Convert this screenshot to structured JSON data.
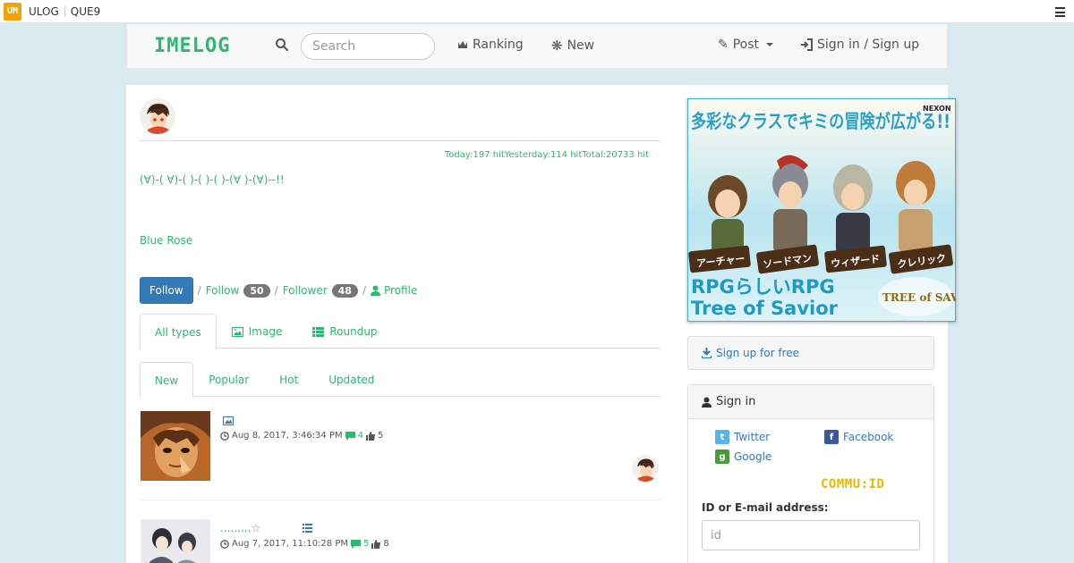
{
  "topbar": {
    "logo": "UM",
    "links": [
      "ULOG",
      "QUE9"
    ]
  },
  "navbar": {
    "brand": "IMELOG",
    "search_placeholder": "Search",
    "ranking": "Ranking",
    "new": "New",
    "post": "Post",
    "sign": "Sign in / Sign up"
  },
  "profile": {
    "hits": "Today:197 hitYesterday:114 hitTotal:20733 hit",
    "message": "(∀)-( ∀)-( )-( )-( )-(∀ )-(∀)--!!",
    "name": "Blue Rose",
    "follow_button": "Follow",
    "follow_label": "Follow",
    "follow_count": "50",
    "follower_label": "Follower",
    "follower_count": "48",
    "profile_label": "Profile"
  },
  "type_tabs": [
    {
      "label": "All types",
      "icon": "",
      "active": true
    },
    {
      "label": "Image",
      "icon": "image-icon",
      "active": false
    },
    {
      "label": "Roundup",
      "icon": "list-icon",
      "active": false
    }
  ],
  "sort_tabs": [
    {
      "label": "New",
      "active": true
    },
    {
      "label": "Popular",
      "active": false
    },
    {
      "label": "Hot",
      "active": false
    },
    {
      "label": "Updated",
      "active": false
    }
  ],
  "entries": [
    {
      "title": "",
      "type_icon": "image-icon",
      "date": "Aug 8, 2017, 3:46:34 PM",
      "comments": "4",
      "likes": "5"
    },
    {
      "title": ".........☆",
      "type_icon": "list-icon",
      "date": "Aug 7, 2017, 11:10:28 PM",
      "comments": "5",
      "likes": "8"
    }
  ],
  "ad": {
    "headline": "多彩なクラスでキミの冒険が広がる!!",
    "publisher": "NEXON",
    "classes": [
      "アーチャー",
      "ソードマン",
      "ウィザード",
      "クレリック"
    ],
    "tagline1": "RPGらしいRPG",
    "tagline2": "Tree of Savior",
    "logo_text": "TREE of SAVIOR"
  },
  "sidebar": {
    "signup": "Sign up for free",
    "signin_title": "Sign in",
    "twitter": "Twitter",
    "facebook": "Facebook",
    "google": "Google",
    "commu": "COMMU:ID",
    "id_label": "ID or E-mail address:",
    "id_placeholder": "id"
  },
  "colors": {
    "accent": "#2fb574",
    "link": "#337ab7",
    "background": "#d9eaf1"
  }
}
